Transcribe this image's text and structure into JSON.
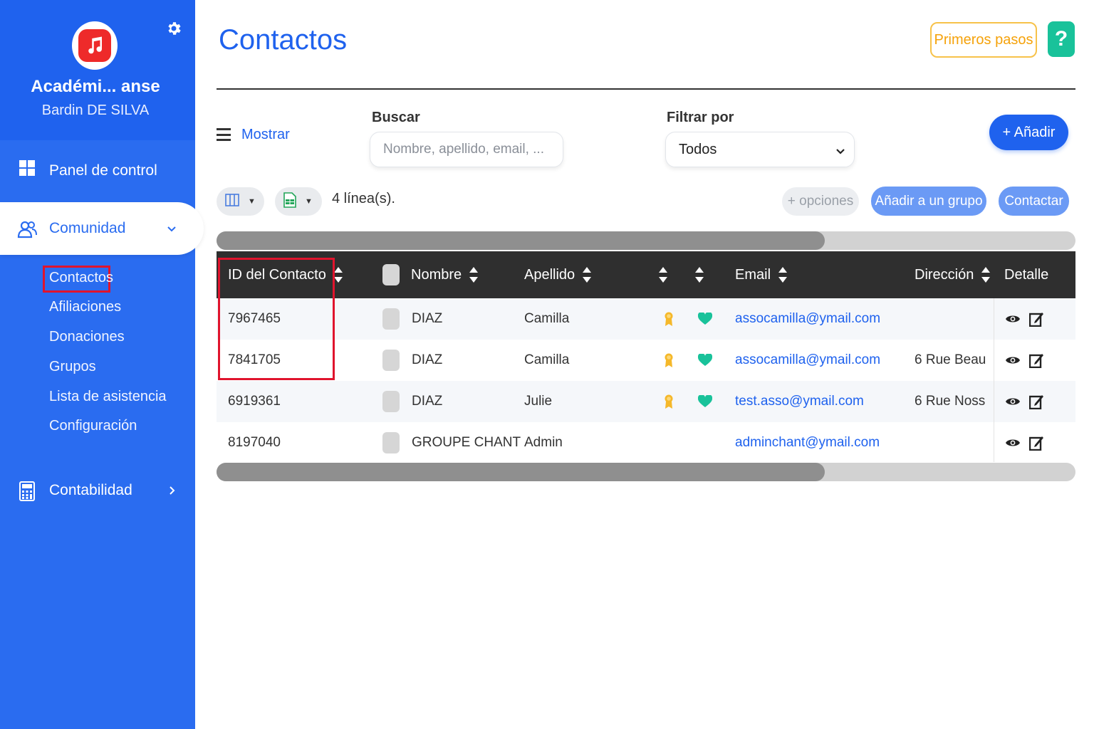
{
  "sidebar": {
    "org_name": "Académi... anse",
    "user_name": "Bardin DE SILVA",
    "nav": {
      "panel": "Panel de control",
      "comunidad": "Comunidad",
      "contabilidad": "Contabilidad"
    },
    "sub_items": [
      "Contactos",
      "Afiliaciones",
      "Donaciones",
      "Grupos",
      "Lista de asistencia",
      "Configuración"
    ]
  },
  "header": {
    "title": "Contactos",
    "primeros_pasos": "Primeros pasos",
    "help": "?"
  },
  "toolbar": {
    "mostrar": "Mostrar",
    "buscar_label": "Buscar",
    "search_placeholder": "Nombre, apellido, email, ...",
    "filtrar_label": "Filtrar por",
    "filter_value": "Todos",
    "add": "+ Añadir",
    "lines": "4 línea(s).",
    "opciones": "+ opciones",
    "add_group": "Añadir a un grupo",
    "contact": "Contactar"
  },
  "table": {
    "columns": {
      "id": "ID del Contacto",
      "nombre": "Nombre",
      "apellido": "Apellido",
      "email": "Email",
      "direccion": "Dirección",
      "detalle": "Detalle"
    },
    "rows": [
      {
        "id": "7967465",
        "nombre": "DIAZ",
        "apellido": "Camilla",
        "email": "assocamilla@ymail.com",
        "direccion": "",
        "member": true,
        "favorite": true
      },
      {
        "id": "7841705",
        "nombre": "DIAZ",
        "apellido": "Camilla",
        "email": "assocamilla@ymail.com",
        "direccion": "6 Rue Beau",
        "member": true,
        "favorite": true
      },
      {
        "id": "6919361",
        "nombre": "DIAZ",
        "apellido": "Julie",
        "email": "test.asso@ymail.com",
        "direccion": "6 Rue Noss",
        "member": true,
        "favorite": true
      },
      {
        "id": "8197040",
        "nombre": "GROUPE CHANT",
        "apellido": "Admin",
        "email": "adminchant@ymail.com",
        "direccion": "",
        "member": false,
        "favorite": false
      }
    ]
  },
  "icons": {
    "logo": "music-note-icon",
    "settings": "gear-icon",
    "member": "medal-icon",
    "favorite": "heart-icon",
    "view": "eye-icon",
    "edit": "edit-icon"
  },
  "colors": {
    "brand": "#1f62ee",
    "sidebar": "#2a6cf0",
    "help": "#19c29a",
    "highlight": "#e0142d",
    "primeros": "#f5a20a"
  }
}
